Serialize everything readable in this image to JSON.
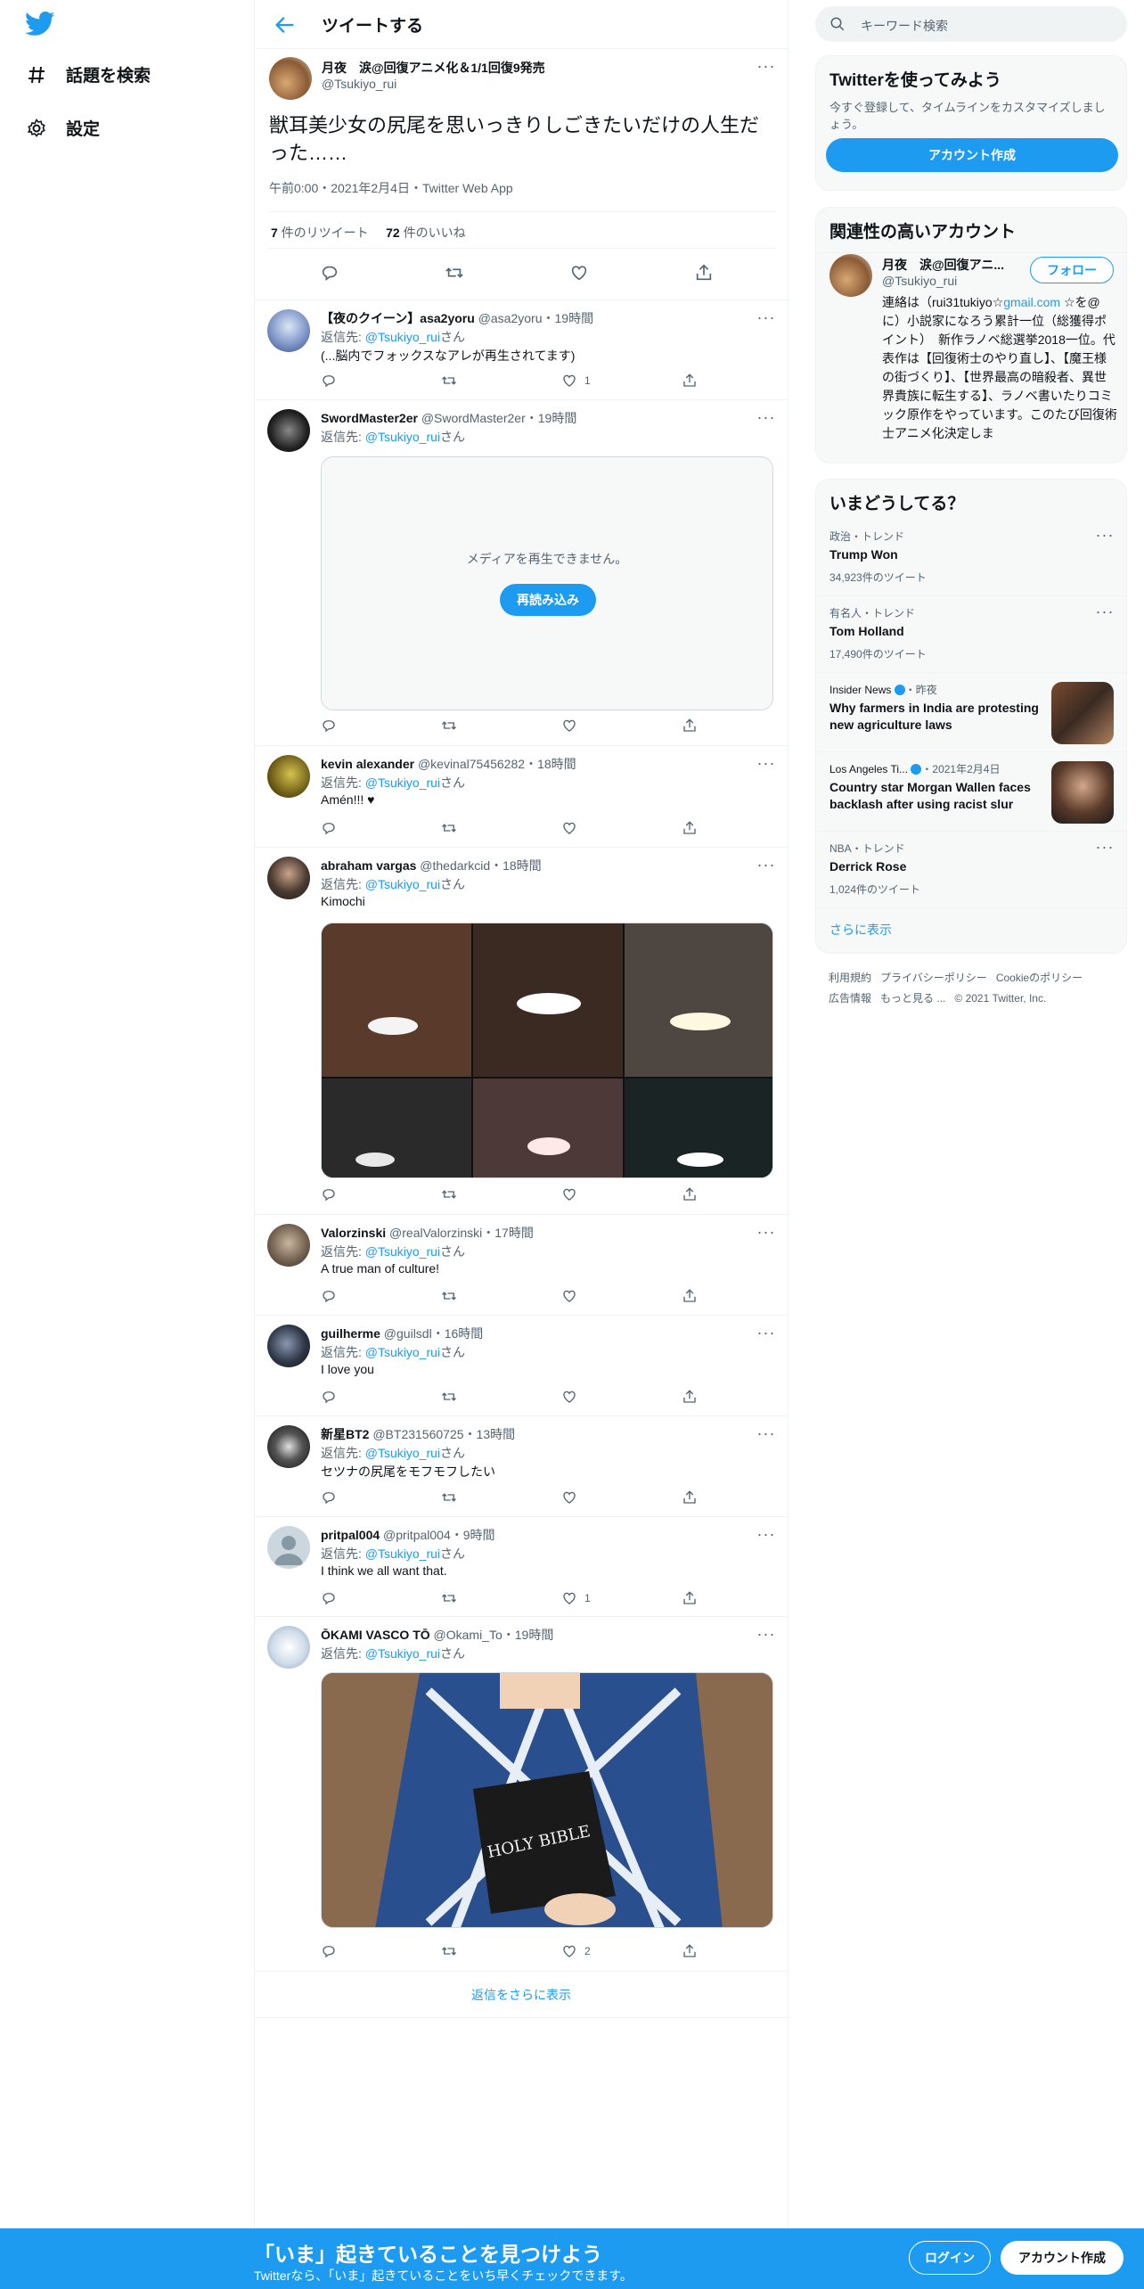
{
  "colors": {
    "accent": "#1d9bf0",
    "heart": "#e0245e",
    "text": "#0f1419",
    "muted": "#536471"
  },
  "nav": {
    "logo_icon": "twitter-bird-icon",
    "explore_label": "話題を検索",
    "settings_label": "設定"
  },
  "header": {
    "title": "ツイートする"
  },
  "main_tweet": {
    "author_name": "月夜　涙@回復アニメ化＆1/1回復9発売",
    "author_handle": "@Tsukiyo_rui",
    "text": "獣耳美少女の尻尾を思いっきりしごきたいだけの人生だった……",
    "meta": "午前0:00・2021年2月4日・Twitter Web App",
    "retweet_count": "7",
    "retweet_label": " 件のリツイート",
    "like_count": "72",
    "like_label": " 件のいいね"
  },
  "reply_to_label": "返信先: ",
  "reply_to_handle": "@Tsukiyo_rui",
  "reply_to_suffix": "さん",
  "replies": [
    {
      "name": "【夜のクイーン】asa2yoru",
      "handle": "@asa2yoru",
      "time": "19時間",
      "text": "(...脳内でフォックスなアレが再生されてます)",
      "likes": "1"
    },
    {
      "name": "SwordMaster2er",
      "handle": "@SwordMaster2er",
      "time": "19時間",
      "text": "",
      "media_msg": "メディアを再生できません。",
      "media_btn": "再読み込み"
    },
    {
      "name": "kevin alexander",
      "handle": "@kevinal75456282",
      "time": "18時間",
      "text": "Amén!!! ♥"
    },
    {
      "name": "abraham vargas",
      "handle": "@thedarkcid",
      "time": "18時間",
      "text": "Kimochi"
    },
    {
      "name": "Valorzinski",
      "handle": "@realValorzinski",
      "time": "17時間",
      "text": "A true man of culture!"
    },
    {
      "name": "guilherme",
      "handle": "@guilsdl",
      "time": "16時間",
      "text": "I love you"
    },
    {
      "name": "新星BT2",
      "handle": "@BT231560725",
      "time": "13時間",
      "text": "セツナの尻尾をモフモフしたい"
    },
    {
      "name": "pritpal004",
      "handle": "@pritpal004",
      "time": "9時間",
      "text": "I think we all want that.",
      "likes": "1"
    },
    {
      "name": "ŌKAMI VASCO TŌ",
      "handle": "@Okami_To",
      "time": "19時間",
      "text": "",
      "likes": "2",
      "media_caption": "HOLY BIBLE"
    }
  ],
  "more_replies": "返信をさらに表示",
  "search": {
    "placeholder": "キーワード検索"
  },
  "signup_card": {
    "title": "Twitterを使ってみよう",
    "subtitle": "今すぐ登録して、タイムラインをカスタマイズしましょう。",
    "button": "アカウント作成"
  },
  "relevant": {
    "title": "関連性の高いアカウント",
    "name": "月夜　涙@回復アニ...",
    "handle": "@Tsukiyo_rui",
    "follow": "フォロー",
    "bio_prefix": "連絡は（rui31tukiyo☆",
    "bio_link": "gmail.com",
    "bio_rest": " ☆を@に）小説家になろう累計一位（総獲得ポイント）　新作ラノベ総選挙2018一位。代表作は【回復術士のやり直し】、【魔王様の街づくり】、【世界最高の暗殺者、異世界貴族に転生する】、ラノベ書いたりコミック原作をやっています。このたび回復術士アニメ化決定しま"
  },
  "trends": {
    "title": "いまどうしてる？",
    "items": [
      {
        "context": "政治・トレンド",
        "title": "Trump Won",
        "count": "34,923件のツイート"
      },
      {
        "context": "有名人・トレンド",
        "title": "Tom Holland",
        "count": "17,490件のツイート"
      },
      {
        "context": "Insider News",
        "time": "・昨夜",
        "title": "Why farmers in India are protesting new agriculture laws"
      },
      {
        "context": "Los Angeles Ti...",
        "time": "・2021年2月4日",
        "title": "Country star Morgan Wallen faces backlash after using racist slur"
      },
      {
        "context": "NBA・トレンド",
        "title": "Derrick Rose",
        "count": "1,024件のツイート"
      }
    ],
    "show_more": "さらに表示"
  },
  "footer": {
    "line1": [
      "利用規約",
      "プライバシーポリシー",
      "Cookieのポリシー"
    ],
    "line2": [
      "広告情報",
      "もっと見る ...",
      "© 2021 Twitter, Inc."
    ]
  },
  "banner": {
    "title": "「いま」起きていることを見つけよう",
    "subtitle": "Twitterなら、「いま」起きていることをいち早くチェックできます。",
    "login": "ログイン",
    "signup": "アカウント作成"
  }
}
